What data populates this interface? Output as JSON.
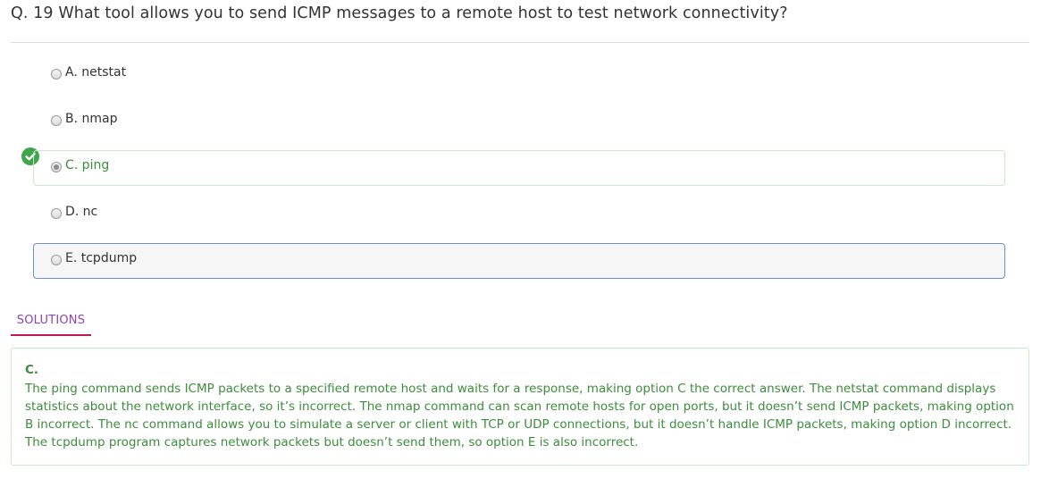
{
  "question": {
    "text": "Q. 19  What tool allows you to send ICMP messages to a remote host to test network connectivity?"
  },
  "options": [
    {
      "label": "A. netstat"
    },
    {
      "label": "B. nmap"
    },
    {
      "label": "C. ping"
    },
    {
      "label": "D. nc"
    },
    {
      "label": "E. tcpdump"
    }
  ],
  "state": {
    "correct_option": "C",
    "selected_option": "E",
    "correct_color": "#3c8d3c",
    "selected_border_color": "#6f8fc6"
  },
  "icons": {
    "correct_marker": "check-circle-icon"
  },
  "solutions": {
    "tab_label": "SOLUTIONS",
    "answer": "C.",
    "text": "The ping command sends ICMP packets to a specified remote host and waits for a response, making option C the correct answer. The netstat command displays statistics about the network interface, so it’s incorrect. The nmap command can scan remote hosts for open ports, but it doesn’t send ICMP packets, making option B incorrect. The nc command allows you to simulate a server or client with TCP or UDP connections, but it doesn’t handle ICMP packets, making option D incorrect. The tcpdump program captures network packets but doesn’t send them, so option E is also incorrect."
  }
}
